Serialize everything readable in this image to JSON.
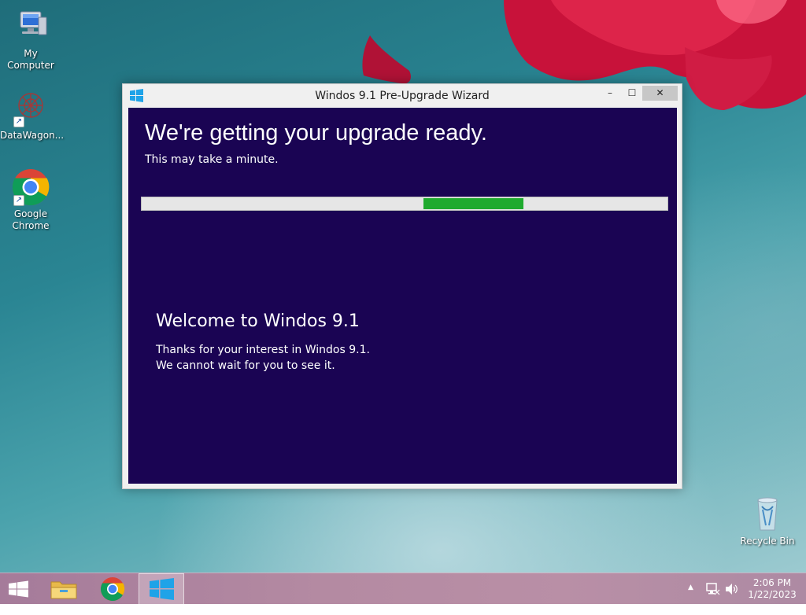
{
  "desktop": {
    "icons": [
      {
        "label": "My Computer",
        "icon": "my-computer-icon"
      },
      {
        "label": "DataWagon...",
        "icon": "datawagon-icon"
      },
      {
        "label": "Google Chrome",
        "icon": "chrome-icon"
      },
      {
        "label": "Recycle Bin",
        "icon": "recycle-bin-icon"
      }
    ]
  },
  "wizard": {
    "title": "Windos 9.1 Pre-Upgrade Wizard",
    "controls": {
      "minimize": "–",
      "maximize": "☐",
      "close": "✕"
    },
    "headline": "We're getting your upgrade ready.",
    "subline": "This may take a minute.",
    "progress": {
      "style": "indeterminate-marquee",
      "color": "#1faa2e"
    },
    "welcome": {
      "title": "Welcome to Windos 9.1",
      "line1": "Thanks for your interest in Windos 9.1.",
      "line2": "We cannot wait for you to see it."
    },
    "colors": {
      "content_bg": "#1a0453",
      "frame": "#f0f0f0"
    }
  },
  "taskbar": {
    "buttons": [
      {
        "icon": "start-windows-icon"
      },
      {
        "icon": "file-explorer-icon"
      },
      {
        "icon": "chrome-icon"
      },
      {
        "icon": "windows-app-icon",
        "active": true
      }
    ],
    "tray": {
      "icons": [
        "show-hidden-icons-icon",
        "network-icon",
        "volume-icon"
      ],
      "time": "2:06 PM",
      "date": "1/22/2023"
    }
  }
}
